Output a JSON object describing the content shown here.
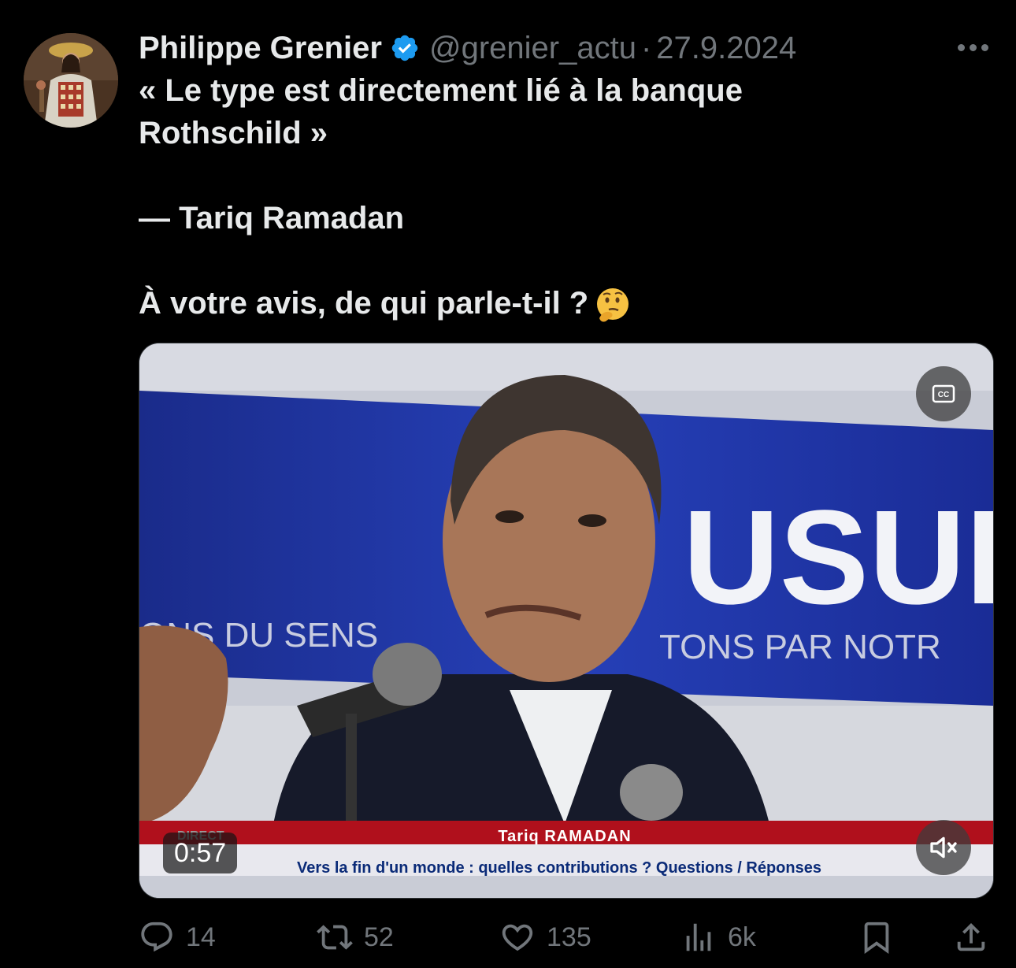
{
  "tweet": {
    "author_name": "Philippe Grenier",
    "handle": "@grenier_actu",
    "separator": "·",
    "date": "27.9.2024",
    "line1": "« Le type est directement lié à la banque",
    "line2": "Rothschild »",
    "line3": "— Tariq Ramadan",
    "line4": "À votre avis, de qui parle-t-il ?",
    "emoji_icon": "thinking-face-icon"
  },
  "video": {
    "duration": "0:57",
    "banner_name": "Tariq RAMADAN",
    "banner_subtitle": "Vers la fin d'un monde : quelles contributions ? Questions / Réponses",
    "banner_direct": "DIRECT",
    "backdrop_big": "USULI",
    "backdrop_left": "ONS DU SENS",
    "backdrop_right": "TONS PAR NOTR",
    "cc_label": "CC"
  },
  "actions": {
    "replies": "14",
    "reposts": "52",
    "likes": "135",
    "views": "6k"
  },
  "colors": {
    "background": "#000000",
    "text": "#e7e9ea",
    "muted": "#71767b",
    "verified": "#1d9bf0",
    "banner_red": "#b0101c"
  }
}
